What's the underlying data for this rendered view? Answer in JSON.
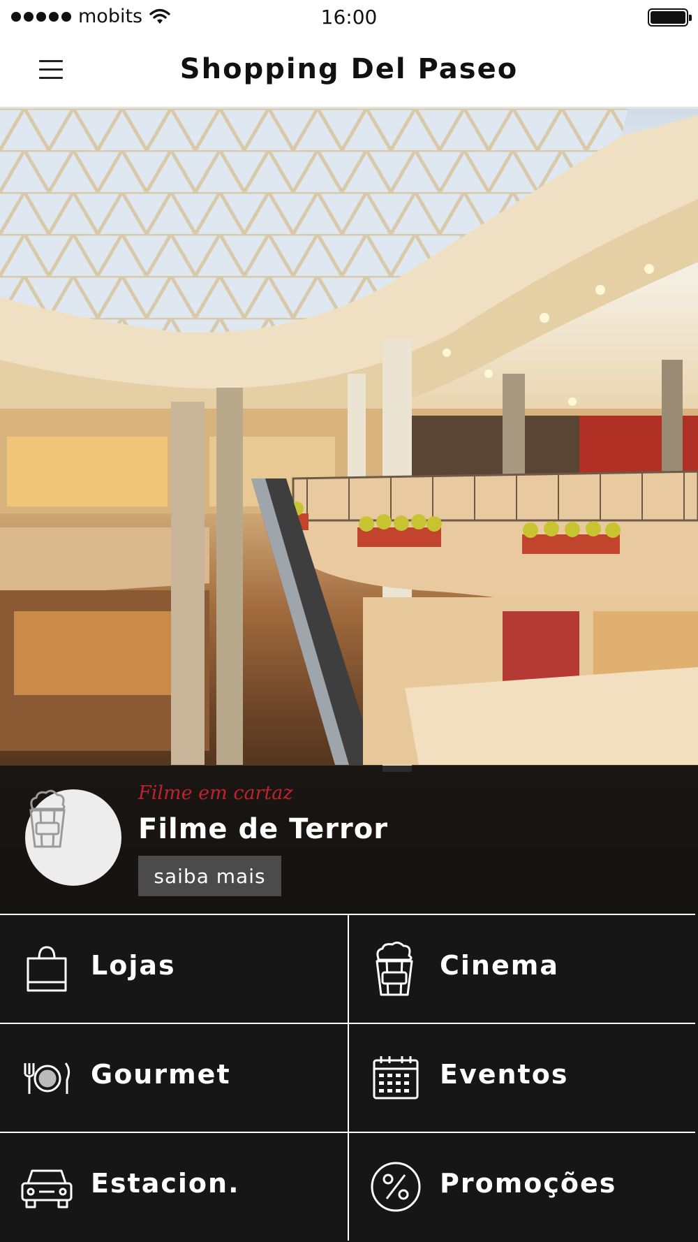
{
  "status_bar": {
    "carrier": "mobits",
    "time": "16:00"
  },
  "nav": {
    "title": "Shopping Del Paseo"
  },
  "banner": {
    "subtitle": "Filme em cartaz",
    "title": "Filme de Terror",
    "button_label": "saiba mais"
  },
  "menu": [
    {
      "label": "Lojas",
      "icon": "shopping-bag-icon"
    },
    {
      "label": "Cinema",
      "icon": "popcorn-icon"
    },
    {
      "label": "Gourmet",
      "icon": "plate-cutlery-icon"
    },
    {
      "label": "Eventos",
      "icon": "calendar-icon"
    },
    {
      "label": "Estacion.",
      "icon": "car-icon"
    },
    {
      "label": "Promoções",
      "icon": "percent-icon"
    }
  ],
  "colors": {
    "accent": "#c0232f",
    "tile_bg": "#161616",
    "button_bg": "#4b4b4b"
  }
}
